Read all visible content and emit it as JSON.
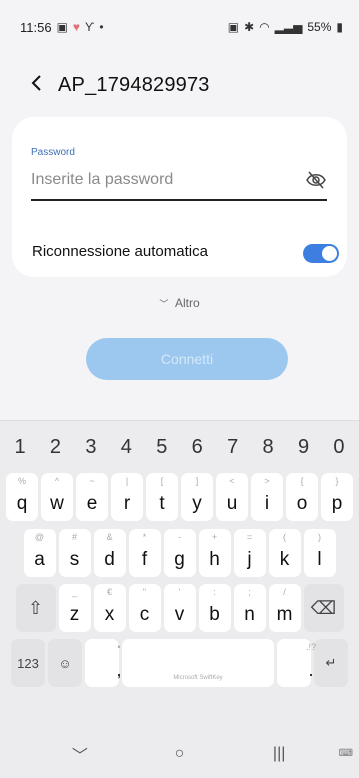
{
  "status": {
    "time": "11:56",
    "left_icons": [
      "image-icon",
      "heart-icon",
      "antenna-icon",
      "dot-icon"
    ],
    "right_icons": [
      "lock-icon",
      "bluetooth-icon",
      "wifi-icon",
      "signal-icon"
    ],
    "battery": "55%"
  },
  "header": {
    "title": "AP_1794829973"
  },
  "password": {
    "label": "Password",
    "placeholder": "Inserite la password"
  },
  "auto_reconnect": {
    "label": "Riconnessione automatica",
    "enabled": true
  },
  "more": {
    "label": "Altro"
  },
  "connect": {
    "label": "Connetti"
  },
  "keyboard": {
    "numbers": [
      "1",
      "2",
      "3",
      "4",
      "5",
      "6",
      "7",
      "8",
      "9",
      "0"
    ],
    "row1": [
      {
        "main": "q",
        "hint": "%"
      },
      {
        "main": "w",
        "hint": "^"
      },
      {
        "main": "e",
        "hint": "~"
      },
      {
        "main": "r",
        "hint": "|"
      },
      {
        "main": "t",
        "hint": "["
      },
      {
        "main": "y",
        "hint": "]"
      },
      {
        "main": "u",
        "hint": "<"
      },
      {
        "main": "i",
        "hint": ">"
      },
      {
        "main": "o",
        "hint": "{"
      },
      {
        "main": "p",
        "hint": "}"
      }
    ],
    "row2": [
      {
        "main": "a",
        "hint": "@"
      },
      {
        "main": "s",
        "hint": "#"
      },
      {
        "main": "d",
        "hint": "&"
      },
      {
        "main": "f",
        "hint": "*"
      },
      {
        "main": "g",
        "hint": "-"
      },
      {
        "main": "h",
        "hint": "+"
      },
      {
        "main": "j",
        "hint": "="
      },
      {
        "main": "k",
        "hint": "("
      },
      {
        "main": "l",
        "hint": ")"
      }
    ],
    "row3": [
      {
        "main": "z",
        "hint": "_"
      },
      {
        "main": "x",
        "hint": "€"
      },
      {
        "main": "c",
        "hint": "\""
      },
      {
        "main": "v",
        "hint": "'"
      },
      {
        "main": "b",
        "hint": ":"
      },
      {
        "main": "n",
        "hint": ";"
      },
      {
        "main": "m",
        "hint": "/"
      }
    ],
    "shift": "⇧",
    "backspace": "⌫",
    "sym": "123",
    "emoji": "☺",
    "comma": ",",
    "comma_hint": "🎤",
    "space": "Microsoft SwiftKey",
    "period": ".",
    "period_hint": ".!?",
    "enter": "↵"
  },
  "nav": {
    "back": "﹀",
    "home": "○",
    "recents": "|||",
    "kbd": "⌨"
  }
}
